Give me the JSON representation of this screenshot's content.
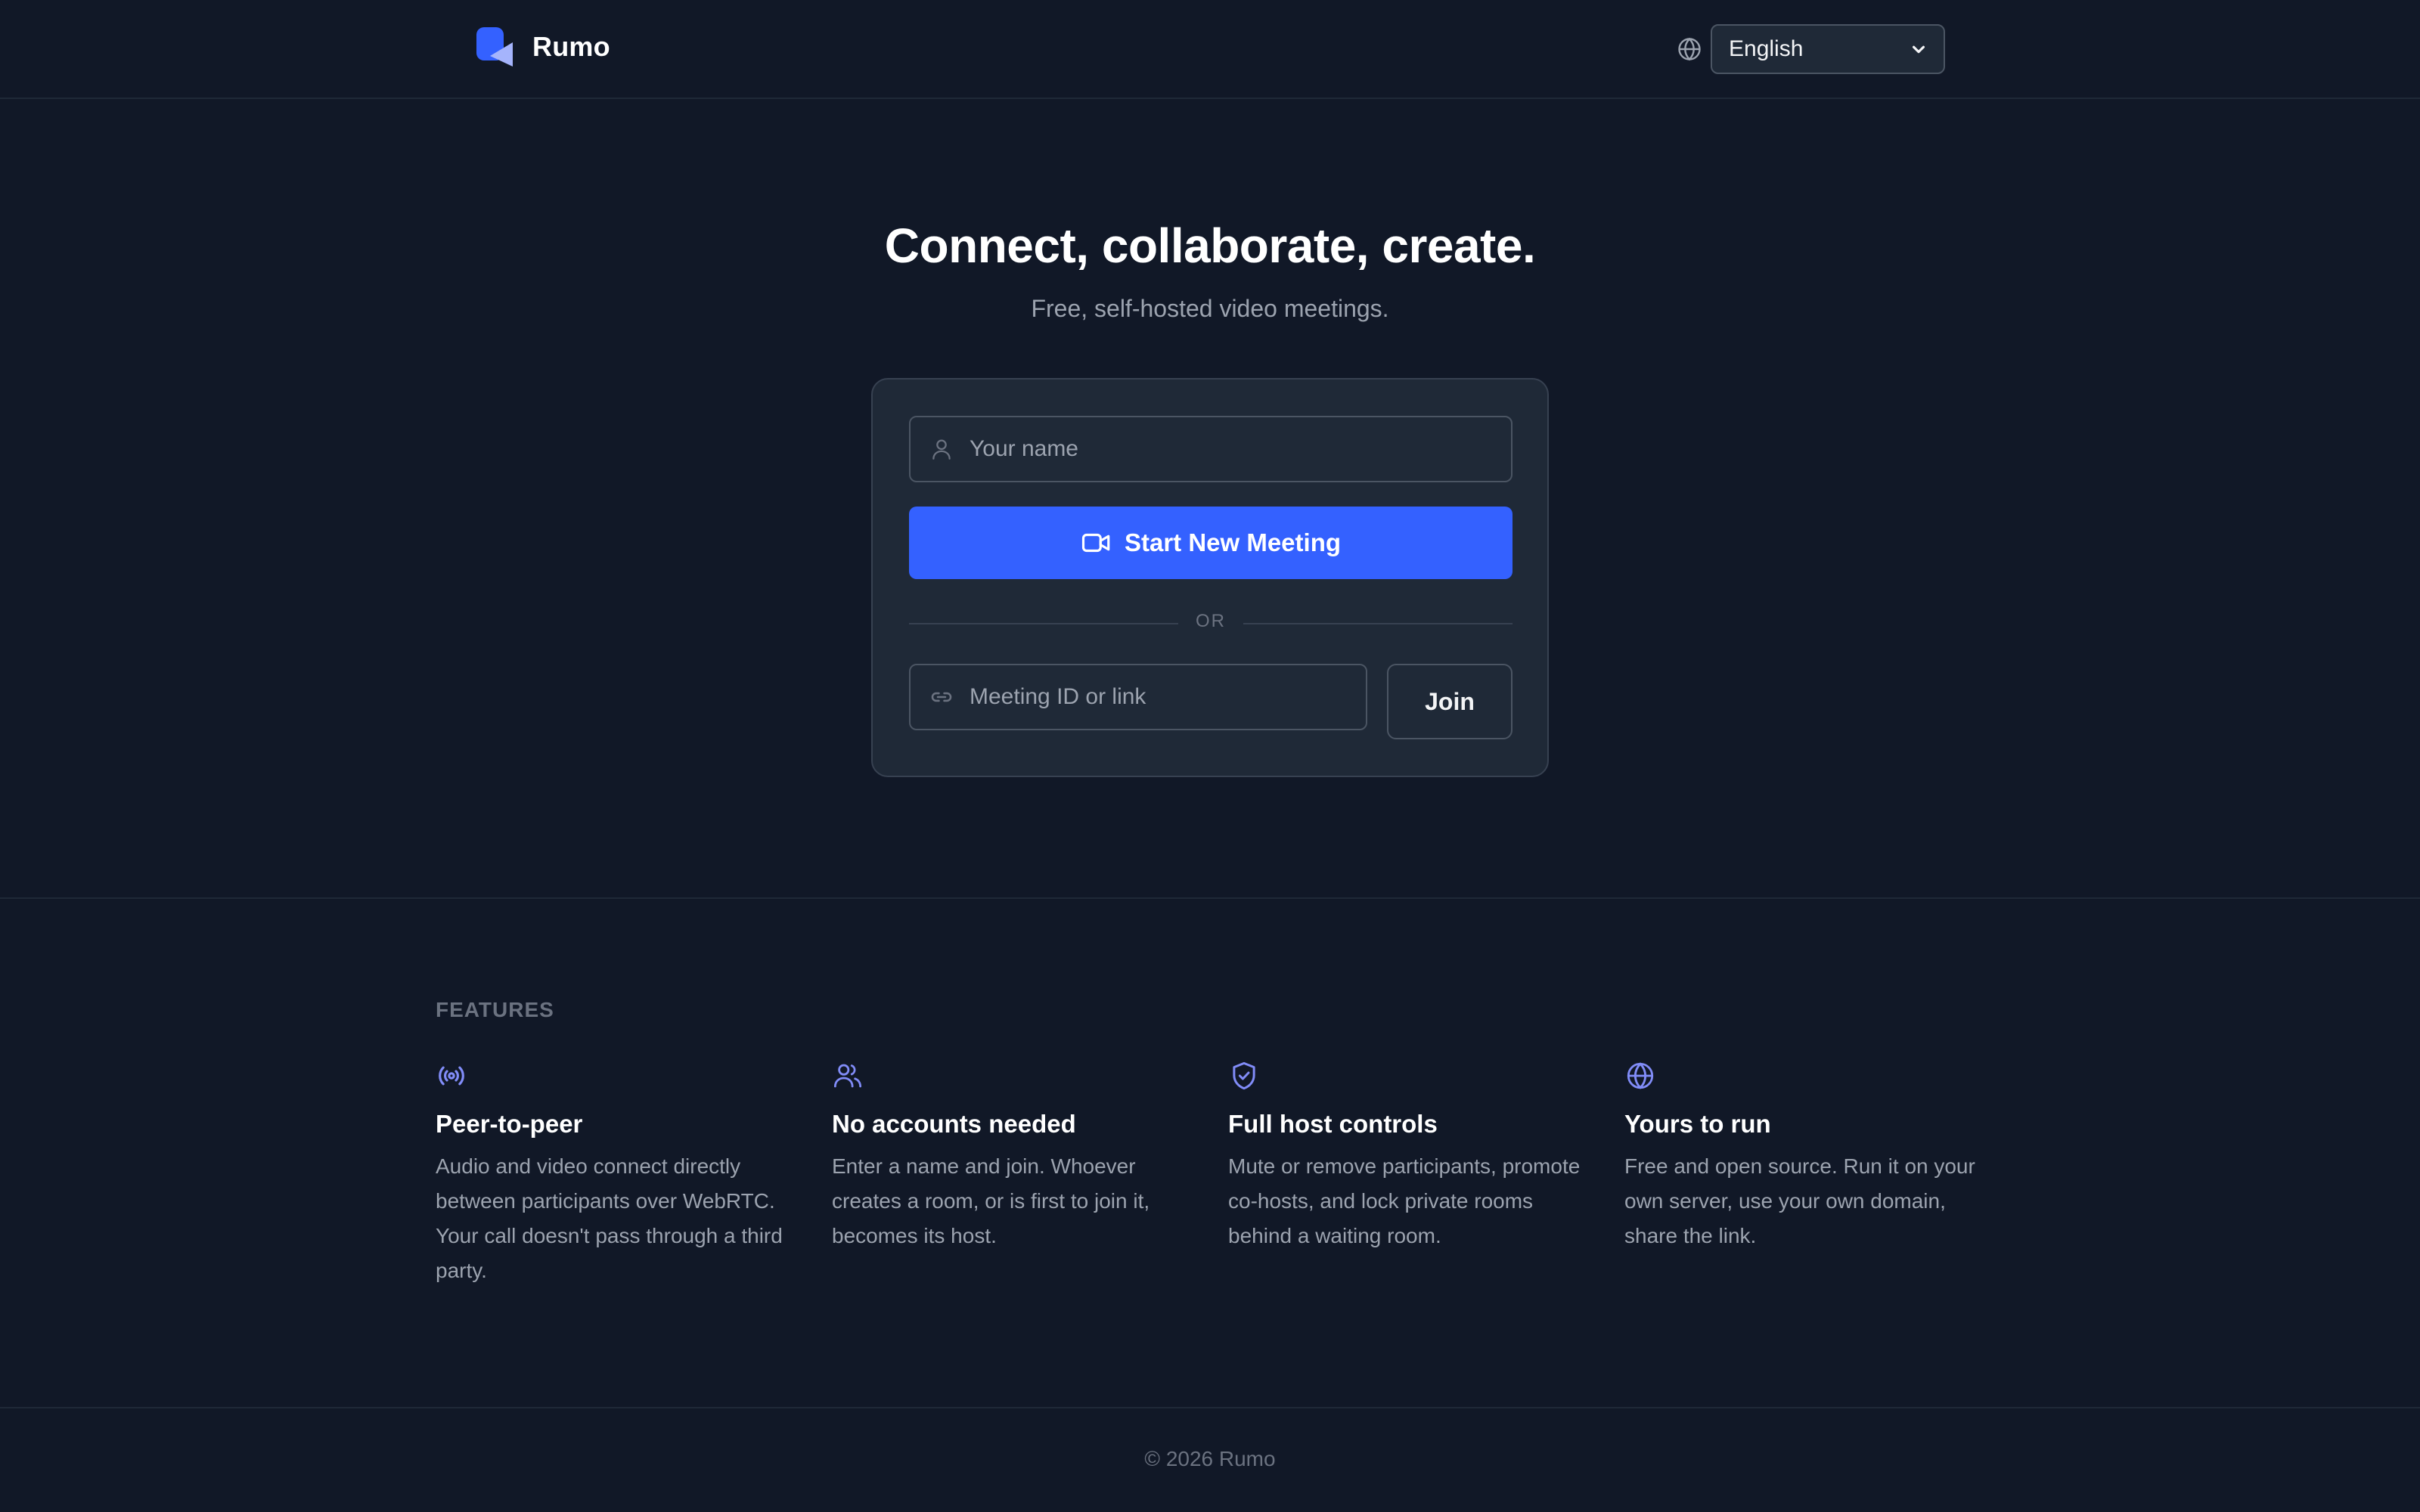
{
  "header": {
    "brand_name": "Rumo",
    "language": {
      "selected": "English"
    }
  },
  "hero": {
    "title": "Connect, collaborate, create.",
    "subtitle": "Free, self-hosted video meetings."
  },
  "card": {
    "name_placeholder": "Your name",
    "start_label": "Start New Meeting",
    "or_label": "OR",
    "meeting_placeholder": "Meeting ID or link",
    "join_label": "Join"
  },
  "features": {
    "heading": "FEATURES",
    "items": [
      {
        "icon": "broadcast-icon",
        "title": "Peer-to-peer",
        "description": "Audio and video connect directly between participants over WebRTC. Your call doesn't pass through a third party."
      },
      {
        "icon": "users-icon",
        "title": "No accounts needed",
        "description": "Enter a name and join. Whoever creates a room, or is first to join it, becomes its host."
      },
      {
        "icon": "shield-check-icon",
        "title": "Full host controls",
        "description": "Mute or remove participants, promote co-hosts, and lock private rooms behind a waiting room."
      },
      {
        "icon": "globe-icon",
        "title": "Yours to run",
        "description": "Free and open source. Run it on your own server, use your own domain, share the link."
      }
    ]
  },
  "footer": {
    "copyright": "© 2026 Rumo"
  },
  "colors": {
    "background": "#111827",
    "card": "#1f2937",
    "accent": "#3461ff",
    "icon_accent": "#818cf8"
  }
}
